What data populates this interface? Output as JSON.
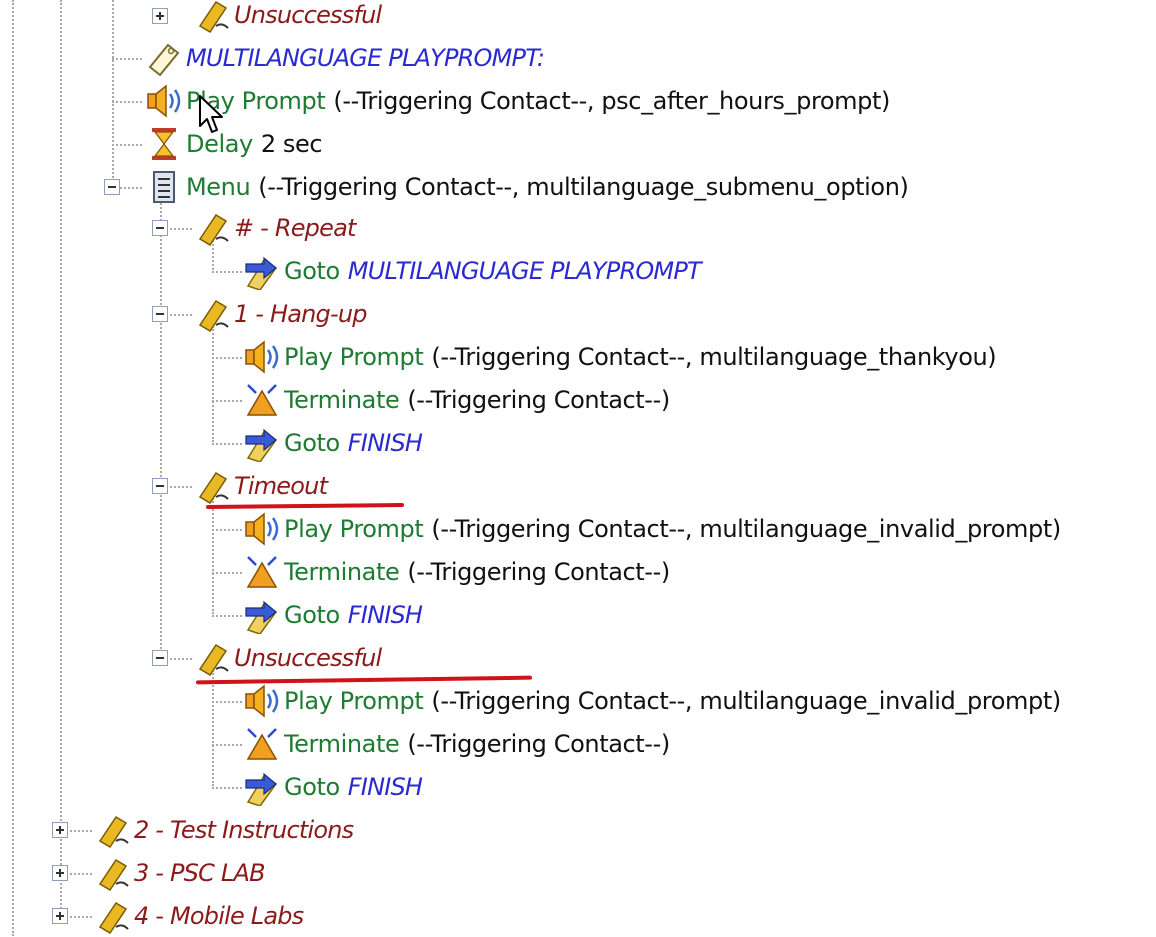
{
  "tree": {
    "top_partial": {
      "label": "Unsuccessful"
    },
    "section_label": {
      "text": "MULTILANGUAGE PLAYPROMPT:"
    },
    "step_play_prompt": {
      "name": "Play Prompt",
      "args": "(--Triggering Contact--, psc_after_hours_prompt)"
    },
    "step_delay": {
      "name": "Delay",
      "args": "2 sec"
    },
    "step_menu": {
      "name": "Menu",
      "args": "(--Triggering Contact--, multilanguage_submenu_option)"
    },
    "branch_repeat": {
      "label": "# - Repeat"
    },
    "repeat_goto": {
      "name": "Goto",
      "target": "MULTILANGUAGE PLAYPROMPT"
    },
    "branch_hangup": {
      "label": "1 - Hang-up"
    },
    "hangup_play": {
      "name": "Play Prompt",
      "args": "(--Triggering Contact--, multilanguage_thankyou)"
    },
    "hangup_terminate": {
      "name": "Terminate",
      "args": "(--Triggering Contact--)"
    },
    "hangup_goto": {
      "name": "Goto",
      "target": "FINISH"
    },
    "branch_timeout": {
      "label": "Timeout"
    },
    "timeout_play": {
      "name": "Play Prompt",
      "args": "(--Triggering Contact--, multilanguage_invalid_prompt)"
    },
    "timeout_terminate": {
      "name": "Terminate",
      "args": "(--Triggering Contact--)"
    },
    "timeout_goto": {
      "name": "Goto",
      "target": "FINISH"
    },
    "branch_unsuccessful": {
      "label": "Unsuccessful"
    },
    "unsucc_play": {
      "name": "Play Prompt",
      "args": "(--Triggering Contact--, multilanguage_invalid_prompt)"
    },
    "unsucc_terminate": {
      "name": "Terminate",
      "args": "(--Triggering Contact--)"
    },
    "unsucc_goto": {
      "name": "Goto",
      "target": "FINISH"
    },
    "root_2": {
      "label": "2 - Test Instructions"
    },
    "root_3": {
      "label": "3 - PSC LAB"
    },
    "root_4": {
      "label": "4 - Mobile Labs"
    }
  },
  "icons": {
    "label": "tag-label-icon",
    "prompt": "speaker-icon",
    "delay": "hourglass-icon",
    "menu": "menu-icon",
    "goto": "goto-arrow-icon",
    "terminate": "terminate-icon",
    "label_outline": "label-outline-icon"
  },
  "colors": {
    "label": "#8b1a1a",
    "section": "#2a2ad0",
    "step": "#1e7b32",
    "annotation": "#d0121a"
  }
}
